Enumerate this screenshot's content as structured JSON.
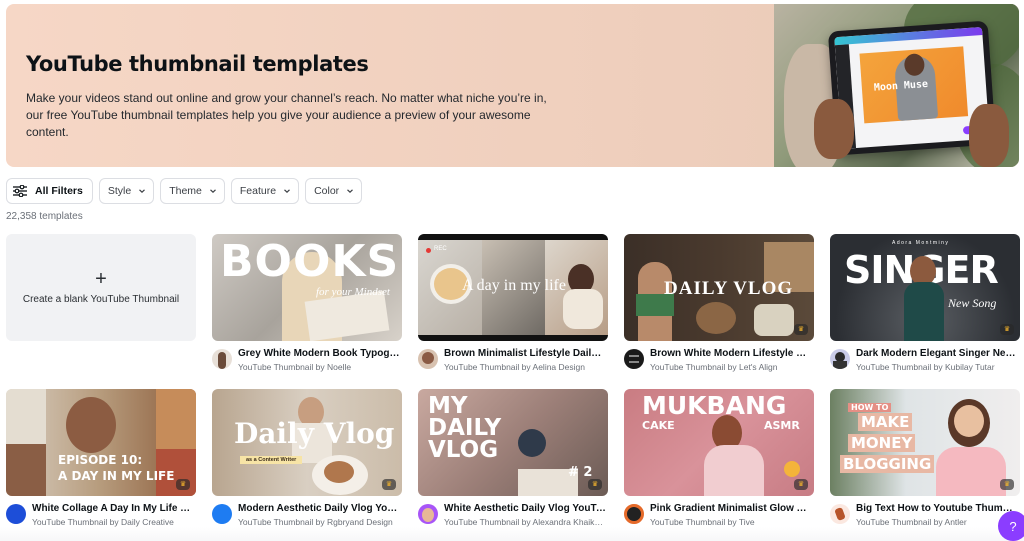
{
  "banner": {
    "title": "YouTube thumbnail templates",
    "description": "Make your videos stand out online and grow your channel’s reach. No matter what niche you’re in, our free YouTube thumbnail templates help you give your audience a preview of your awesome content.",
    "image_text": "Moon Muse"
  },
  "filters": {
    "all_label": "All Filters",
    "items": [
      {
        "label": "Style"
      },
      {
        "label": "Theme"
      },
      {
        "label": "Feature"
      },
      {
        "label": "Color"
      }
    ]
  },
  "result_count": "22,358 templates",
  "blank_card": {
    "plus": "+",
    "label": "Create a blank YouTube Thumbnail"
  },
  "templates": [
    {
      "title": "Grey White Modern Book Typograp...",
      "subtitle": "YouTube Thumbnail by Noelle",
      "thumb_text": "BOOKS",
      "thumb_subtext": "for your Mindset",
      "premium": false
    },
    {
      "title": "Brown Minimalist Lifestyle Daily Vl...",
      "subtitle": "YouTube Thumbnail by Aelina Design",
      "thumb_text": "A day in my life",
      "thumb_subtext": "REC",
      "premium": false
    },
    {
      "title": "Brown White Modern Lifestyle Vlo...",
      "subtitle": "YouTube Thumbnail by Let's Align",
      "thumb_text": "DAILY VLOG",
      "thumb_subtext": "",
      "premium": true
    },
    {
      "title": "Dark Modern Elegant Singer New S...",
      "subtitle": "YouTube Thumbnail by Kubilay Tutar",
      "thumb_text": "SINGER",
      "thumb_subtext": "New Song",
      "thumb_top": "Adora Montminy",
      "premium": true
    },
    {
      "title": "White Collage A Day In My Life Vlo...",
      "subtitle": "YouTube Thumbnail by Daily Creative",
      "thumb_text": "EPISODE 10:",
      "thumb_subtext": "A DAY IN MY LIFE",
      "premium": true
    },
    {
      "title": "Modern Aesthetic Daily Vlog Youtu...",
      "subtitle": "YouTube Thumbnail by Rgbryand Design",
      "thumb_text": "Daily Vlog",
      "thumb_subtext": "as a Content Writer",
      "premium": true
    },
    {
      "title": "White Aesthetic Daily Vlog YouTub...",
      "subtitle": "YouTube Thumbnail by Alexandra Khaikon...",
      "thumb_text": "MY DAILY VLOG",
      "thumb_subtext": "# 2",
      "premium": true
    },
    {
      "title": "Pink Gradient Minimalist Glow You...",
      "subtitle": "YouTube Thumbnail by Tive",
      "thumb_text": "MUKBANG",
      "thumb_subtext": "CAKE",
      "thumb_subtext2": "ASMR",
      "premium": true
    },
    {
      "title": "Big Text How to Youtube Thumbnail",
      "subtitle": "YouTube Thumbnail by Antler",
      "thumb_text": "HOW TO",
      "thumb_subtext": "MAKE",
      "thumb_subtext2": "MONEY",
      "thumb_subtext3": "BLOGGING",
      "premium": true
    }
  ],
  "premium_icon": "crown-icon",
  "help_button": {
    "label": "?"
  },
  "colors": {
    "accent": "#8b3dff",
    "banner_bg": "#f3d4c3",
    "premium_crown": "#f5b52d"
  }
}
